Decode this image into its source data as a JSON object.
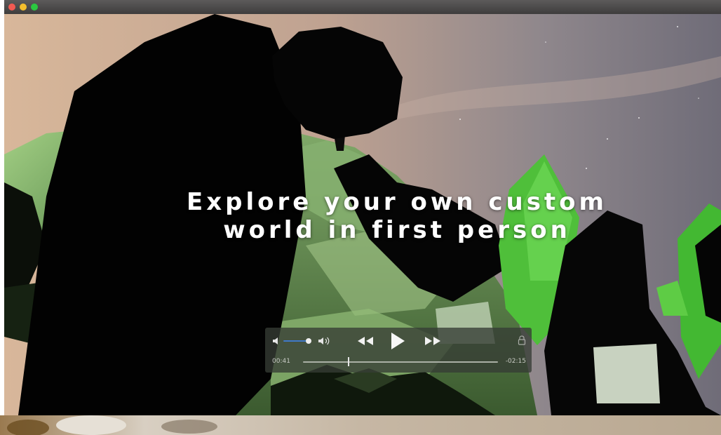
{
  "window": {
    "traffic_lights": [
      "close-button",
      "minimize-button",
      "zoom-button"
    ],
    "colors": {
      "close": "#f25a52",
      "minimize": "#f4be2d",
      "zoom": "#2bc840"
    }
  },
  "video": {
    "caption_line1": "Explore your own custom",
    "caption_line2": "world in first person"
  },
  "player": {
    "elapsed": "00:41",
    "remaining": "-02:15",
    "volume_level": 0.85,
    "progress": 0.23,
    "icons": [
      "volume-low-icon",
      "volume-high-icon",
      "rewind-icon",
      "play-icon",
      "fast-forward-icon",
      "lock-icon"
    ],
    "accent": "#3f79c8"
  }
}
